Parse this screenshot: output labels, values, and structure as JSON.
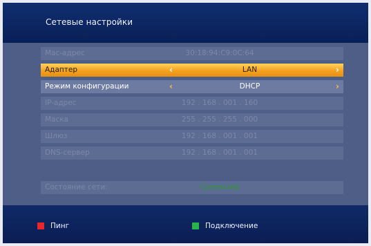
{
  "header": {
    "title": "Сетевые настройки"
  },
  "rows": {
    "mac": {
      "label": "Mac-адрес",
      "value": "30:18:94:C9:0C:64"
    },
    "adapter": {
      "label": "Адаптер",
      "value": "LAN"
    },
    "config_mode": {
      "label": "Режим конфигурации",
      "value": "DHCP"
    },
    "ip": {
      "label": "IP-адрес",
      "value": "192 . 168 . 001 . 160"
    },
    "mask": {
      "label": "Маска",
      "value": "255 . 255 . 255 . 000"
    },
    "gateway": {
      "label": "Шлюз",
      "value": "192 . 168 . 001 . 001"
    },
    "dns": {
      "label": "DNS-сервер",
      "value": "192 . 168 . 001 . 001"
    },
    "status": {
      "label": "Состояние сети:",
      "value": "Connected"
    }
  },
  "footer": {
    "ping_label": "Пинг",
    "connect_label": "Подключение"
  },
  "colors": {
    "red_key": "#e8262b",
    "green_key": "#27b34a",
    "highlight": "#f3a11f"
  }
}
